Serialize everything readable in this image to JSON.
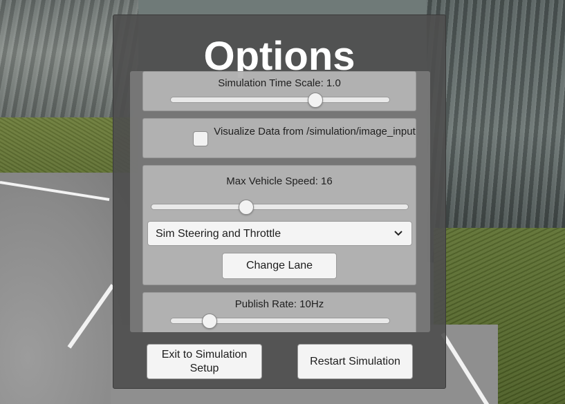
{
  "panel": {
    "title": "Options"
  },
  "time_scale": {
    "label": "Simulation Time Scale: 1.0",
    "slider_fraction": 0.66
  },
  "visualize": {
    "label": "Visualize Data from /simulation/image_input",
    "checked": false
  },
  "vehicle": {
    "max_speed_label": "Max Vehicle Speed: 16",
    "speed_slider_fraction": 0.37,
    "control_mode": {
      "selected": "Sim Steering and Throttle",
      "icon": "chevron-down-icon"
    },
    "change_lane_label": "Change Lane"
  },
  "publish": {
    "label": "Publish Rate: 10Hz",
    "slider_fraction": 0.18
  },
  "footer": {
    "exit_label": "Exit to Simulation Setup",
    "restart_label": "Restart Simulation"
  }
}
